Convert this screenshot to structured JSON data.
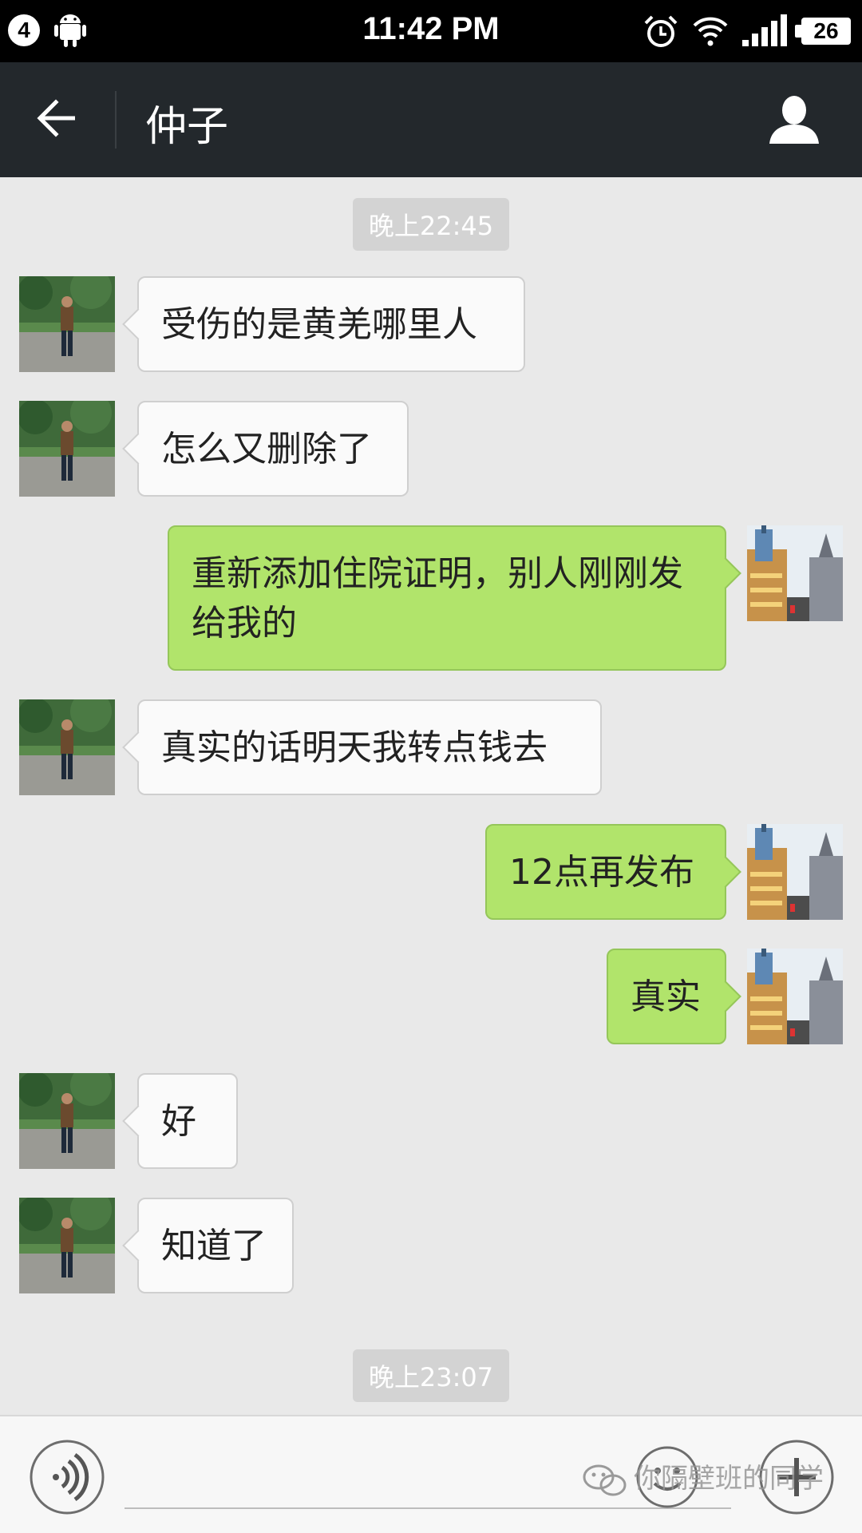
{
  "status_bar": {
    "notification_count": "4",
    "time": "11:42 PM",
    "battery": "26"
  },
  "header": {
    "title": "仲子"
  },
  "timestamps": [
    "晚上22:45",
    "晚上23:07"
  ],
  "messages": [
    {
      "sender": "friend",
      "text": "受伤的是黄羌哪里人"
    },
    {
      "sender": "friend",
      "text": "怎么又删除了"
    },
    {
      "sender": "me",
      "text": "重新添加住院证明，别人刚刚发给我的"
    },
    {
      "sender": "friend",
      "text": "真实的话明天我转点钱去"
    },
    {
      "sender": "me",
      "text": "12点再发布"
    },
    {
      "sender": "me",
      "text": "真实"
    },
    {
      "sender": "friend",
      "text": "好"
    },
    {
      "sender": "friend",
      "text": "知道了"
    }
  ],
  "input_bar": {
    "watermark": "你隔壁班的同学"
  },
  "icons": {
    "back": "arrow-left-icon",
    "profile": "person-icon",
    "voice": "voice-icon",
    "emoji": "smiley-icon",
    "plus": "plus-icon"
  },
  "colors": {
    "header_bg": "#23282c",
    "chat_bg": "#e9e9e9",
    "my_bubble": "#b1e46b",
    "friend_bubble": "#fafafa"
  }
}
